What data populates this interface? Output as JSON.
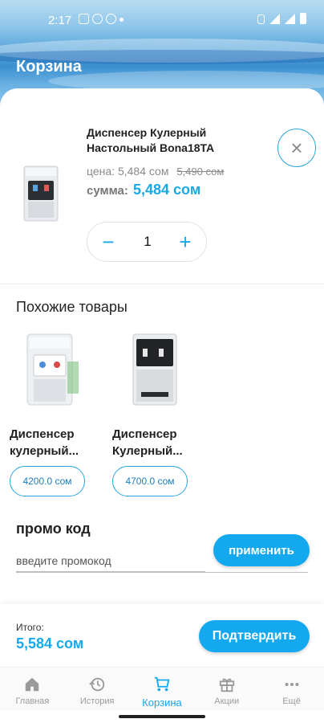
{
  "status_bar": {
    "time": "2:17"
  },
  "header": {
    "title": "Корзина"
  },
  "cart_item": {
    "name": "Диспенсер Кулерный Настольный Bona18TA",
    "price_label": "цена:",
    "price": "5,484 сом",
    "old_price": "5,490 сом",
    "sum_label": "сумма:",
    "sum": "5,484 сом",
    "quantity": "1",
    "minus": "−",
    "plus": "+",
    "remove": "×"
  },
  "similar": {
    "title": "Похожие товары",
    "items": [
      {
        "name": "Диспенсер кулерный...",
        "price": "4200.0 сом"
      },
      {
        "name": "Диспенсер Кулерный...",
        "price": "4700.0 сом"
      }
    ]
  },
  "promo": {
    "title": "промо код",
    "placeholder": "введите промокод",
    "apply_label": "применить"
  },
  "summary": {
    "total_label": "Итого:",
    "total": "5,584 сом",
    "confirm_label": "Подтвердить"
  },
  "nav": [
    {
      "label": "Главная",
      "icon": "home-icon"
    },
    {
      "label": "История",
      "icon": "history-icon"
    },
    {
      "label": "Корзина",
      "icon": "cart-icon",
      "active": true
    },
    {
      "label": "Акции",
      "icon": "gift-icon"
    },
    {
      "label": "Ещё",
      "icon": "more-icon"
    }
  ],
  "colors": {
    "accent": "#14a9ef",
    "outline": "#2aa6df",
    "inactive": "#9a9a9a"
  }
}
